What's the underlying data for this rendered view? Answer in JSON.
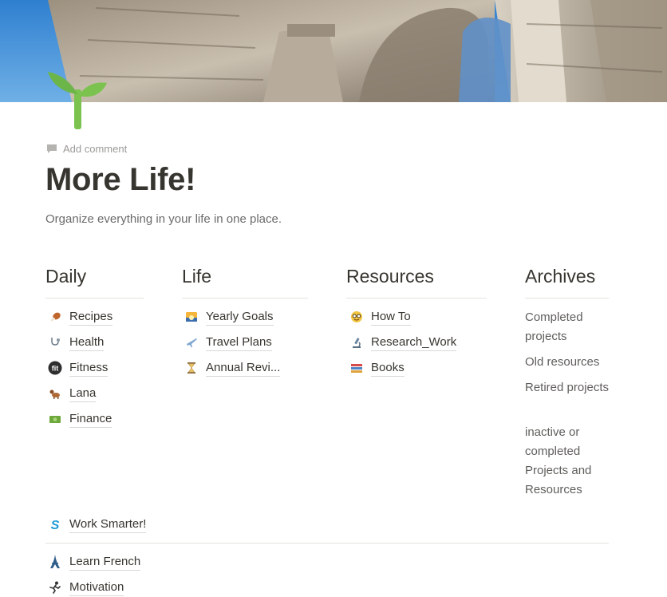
{
  "page": {
    "title": "More Life!",
    "subtitle": "Organize everything in your life in one place.",
    "add_comment": "Add comment",
    "icon": "seedling-icon",
    "cover": "colosseum-arch-photo"
  },
  "columns": {
    "daily": {
      "heading": "Daily",
      "items": [
        {
          "label": "Recipes",
          "icon": "poultry-leg-icon"
        },
        {
          "label": "Health",
          "icon": "stethoscope-icon"
        },
        {
          "label": "Fitness",
          "icon": "fit-badge-icon"
        },
        {
          "label": "Lana",
          "icon": "dog-icon"
        },
        {
          "label": "Finance",
          "icon": "dollar-banknote-icon"
        }
      ]
    },
    "life": {
      "heading": "Life",
      "items": [
        {
          "label": "Yearly Goals",
          "icon": "sunrise-icon"
        },
        {
          "label": "Travel Plans",
          "icon": "airplane-icon"
        },
        {
          "label": "Annual Revi...",
          "icon": "hourglass-icon"
        }
      ]
    },
    "resources": {
      "heading": "Resources",
      "items": [
        {
          "label": "How To",
          "icon": "nerd-face-icon"
        },
        {
          "label": "Research_Work",
          "icon": "microscope-icon"
        },
        {
          "label": "Books",
          "icon": "books-icon"
        }
      ]
    },
    "archives": {
      "heading": "Archives",
      "notes": [
        "Completed projects",
        "Old resources",
        "Retired projects",
        "inactive or completed Projects and Resources"
      ]
    }
  },
  "bottom_links": [
    {
      "label": "Work Smarter!",
      "icon": "s-logo-icon"
    },
    {
      "label": "Learn French",
      "icon": "eiffel-tower-icon"
    },
    {
      "label": "Motivation",
      "icon": "runner-icon"
    }
  ],
  "colors": {
    "text": "#37352f",
    "muted": "#9b9a97",
    "sky": "#3f8fd6",
    "stone": "#b9ad9b",
    "sprout": "#6cb549"
  }
}
